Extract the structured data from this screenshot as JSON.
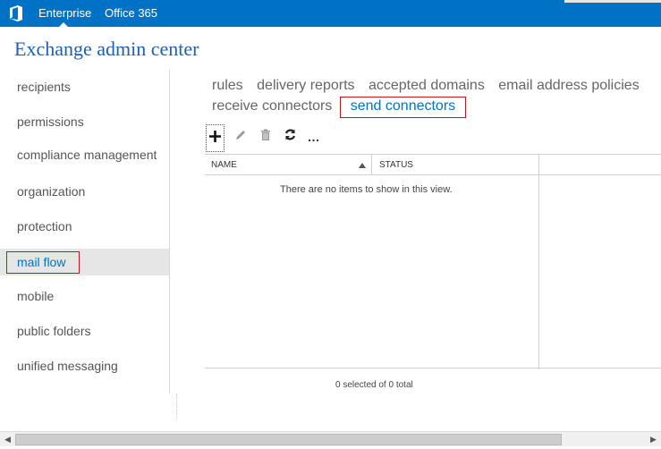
{
  "topbar": {
    "nav_items": [
      "Enterprise",
      "Office 365"
    ],
    "active_item": "Enterprise",
    "brand_color": "#0072c6"
  },
  "app_title": "Exchange admin center",
  "sidebar": {
    "items": [
      {
        "label": "recipients"
      },
      {
        "label": "permissions"
      },
      {
        "label": "compliance management"
      },
      {
        "label": "organization"
      },
      {
        "label": "protection"
      },
      {
        "label": "mail flow",
        "selected": true
      },
      {
        "label": "mobile"
      },
      {
        "label": "public folders"
      },
      {
        "label": "unified messaging"
      }
    ]
  },
  "tabs": {
    "row1": [
      "rules",
      "delivery reports",
      "accepted domains",
      "email address policies"
    ],
    "row2": [
      "receive connectors",
      "send connectors"
    ],
    "active": "send connectors"
  },
  "toolbar": {
    "icons": [
      "add-icon",
      "edit-icon",
      "delete-icon",
      "refresh-icon",
      "more-icon"
    ],
    "more_label": "…"
  },
  "grid": {
    "columns": [
      "NAME",
      "STATUS"
    ],
    "sort_column": "NAME",
    "empty_message": "There are no items to show in this view."
  },
  "status": "0 selected of 0 total",
  "highlight_color": "#c6161d"
}
